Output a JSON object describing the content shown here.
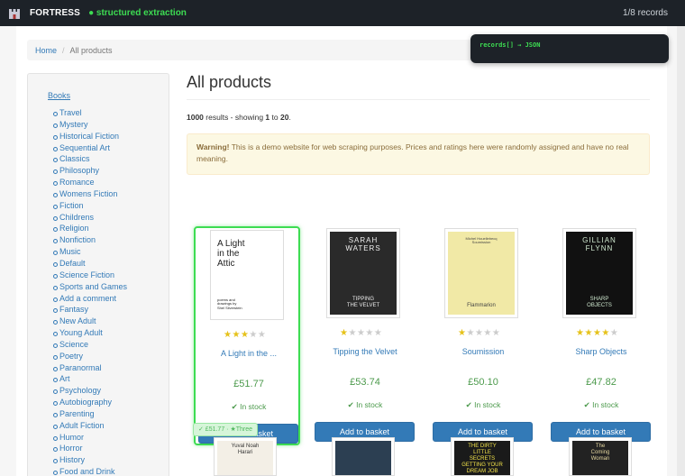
{
  "topbar": {
    "brand": "FORTRESS",
    "mode": "● structured extraction",
    "count": "1/8 records"
  },
  "overlay": {
    "text": "records[] → JSON"
  },
  "breadcrumb": {
    "home": "Home",
    "sep": "/",
    "current": "All products"
  },
  "sidebar": {
    "top": "Books",
    "items": [
      "Travel",
      "Mystery",
      "Historical Fiction",
      "Sequential Art",
      "Classics",
      "Philosophy",
      "Romance",
      "Womens Fiction",
      "Fiction",
      "Childrens",
      "Religion",
      "Nonfiction",
      "Music",
      "Default",
      "Science Fiction",
      "Sports and Games",
      "Add a comment",
      "Fantasy",
      "New Adult",
      "Young Adult",
      "Science",
      "Poetry",
      "Paranormal",
      "Art",
      "Psychology",
      "Autobiography",
      "Parenting",
      "Adult Fiction",
      "Humor",
      "Horror",
      "History",
      "Food and Drink"
    ]
  },
  "main": {
    "title": "All products",
    "results": {
      "total": "1000",
      "mid": " results - showing ",
      "from": "1",
      "to_word": " to ",
      "to": "20",
      "end": "."
    },
    "warning": {
      "bold": "Warning!",
      "text": " This is a demo website for web scraping purposes. Prices and ratings here were randomly assigned and have no real meaning."
    }
  },
  "products": [
    {
      "title": "A Light in the ...",
      "price": "£51.77",
      "stock": "In stock",
      "rating": 3,
      "basket": "Add to basket",
      "cover_text": [
        "A Light",
        "in the",
        "Attic"
      ],
      "cover_sub": [
        "poems and",
        "drawings by",
        "Shel Silverstein"
      ]
    },
    {
      "title": "Tipping the Velvet",
      "price": "£53.74",
      "stock": "In stock",
      "rating": 1,
      "basket": "Add to basket",
      "cover_text": [
        "SARAH",
        "WATERS"
      ],
      "cover_sub": [
        "TIPPING",
        "THE VELVET"
      ]
    },
    {
      "title": "Soumission",
      "price": "£50.10",
      "stock": "In stock",
      "rating": 1,
      "basket": "Add to basket",
      "cover_text": [
        "Michel Houellebecq",
        "Soumission"
      ],
      "cover_sub": [
        "Flammarion"
      ]
    },
    {
      "title": "Sharp Objects",
      "price": "£47.82",
      "stock": "In stock",
      "rating": 4,
      "basket": "Add to basket",
      "cover_text": [
        "GILLIAN",
        "FLYNN"
      ],
      "cover_sub": [
        "SHARP",
        "OBJECTS"
      ]
    }
  ],
  "extract_tag": "✓ £51.77 · ★Three",
  "row2": [
    {
      "cover_text": [
        "Yuval Noah",
        "Harari"
      ]
    },
    {
      "cover_text": [
        ""
      ]
    },
    {
      "cover_text": [
        "THE DIRTY",
        "LITTLE",
        "SECRETS",
        "GETTING YOUR",
        "DREAM JOB"
      ]
    },
    {
      "cover_text": [
        "The",
        "Coming",
        "Woman"
      ]
    }
  ],
  "colors": {
    "topbar": "#1d2228",
    "accent_green": "#3ddc52",
    "link": "#337ab7",
    "price": "#4c9a4c",
    "button": "#337ab7"
  }
}
